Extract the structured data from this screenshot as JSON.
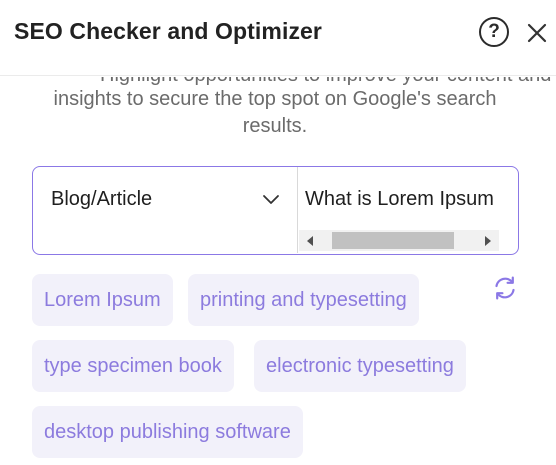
{
  "header": {
    "title": "SEO Checker and Optimizer",
    "help_label": "?"
  },
  "intro": {
    "clipped_text": "Highlight opportunities to improve your content and display",
    "description": "insights to secure the top spot on Google's search results."
  },
  "form": {
    "content_type": "Blog/Article",
    "keyword": "What is Lorem Ipsum"
  },
  "keywords": [
    "Lorem Ipsum",
    "printing and typesetting",
    "type specimen book",
    "electronic typesetting",
    "desktop publishing software"
  ],
  "colors": {
    "accent": "#8b78e6",
    "chip_bg": "#f2f1fa",
    "chip_text": "#8c7bde",
    "text_muted": "#6b6b6b"
  },
  "icons": {
    "help": "question-circle-icon",
    "close": "close-icon",
    "dropdown": "chevron-down-icon",
    "refresh": "refresh-icon"
  }
}
